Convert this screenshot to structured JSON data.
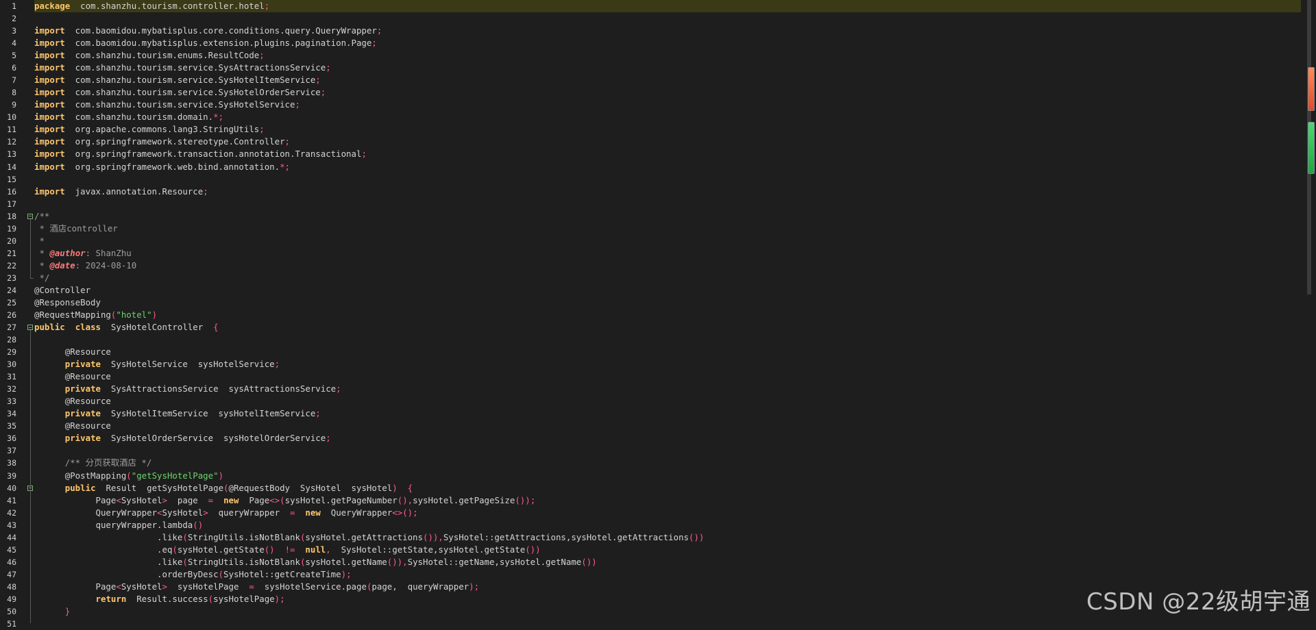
{
  "editor": {
    "current_line": 1,
    "lines": [
      [
        [
          "pk",
          "package"
        ],
        [
          "",
          "  com.shanzhu.tourism.controller.hotel"
        ],
        [
          "pn",
          ";"
        ]
      ],
      [],
      [
        [
          "kw",
          "import"
        ],
        [
          "",
          "  com.baomidou.mybatisplus.core.conditions.query.QueryWrapper"
        ],
        [
          "pn",
          ";"
        ]
      ],
      [
        [
          "kw",
          "import"
        ],
        [
          "",
          "  com.baomidou.mybatisplus.extension.plugins.pagination.Page"
        ],
        [
          "pn",
          ";"
        ]
      ],
      [
        [
          "kw",
          "import"
        ],
        [
          "",
          "  com.shanzhu.tourism.enums.ResultCode"
        ],
        [
          "pn",
          ";"
        ]
      ],
      [
        [
          "kw",
          "import"
        ],
        [
          "",
          "  com.shanzhu.tourism.service.SysAttractionsService"
        ],
        [
          "pn",
          ";"
        ]
      ],
      [
        [
          "kw",
          "import"
        ],
        [
          "",
          "  com.shanzhu.tourism.service.SysHotelItemService"
        ],
        [
          "pn",
          ";"
        ]
      ],
      [
        [
          "kw",
          "import"
        ],
        [
          "",
          "  com.shanzhu.tourism.service.SysHotelOrderService"
        ],
        [
          "pn",
          ";"
        ]
      ],
      [
        [
          "kw",
          "import"
        ],
        [
          "",
          "  com.shanzhu.tourism.service.SysHotelService"
        ],
        [
          "pn",
          ";"
        ]
      ],
      [
        [
          "kw",
          "import"
        ],
        [
          "",
          "  com.shanzhu.tourism.domain."
        ],
        [
          "pn",
          "*;"
        ]
      ],
      [
        [
          "kw",
          "import"
        ],
        [
          "",
          "  org.apache.commons.lang3.StringUtils"
        ],
        [
          "pn",
          ";"
        ]
      ],
      [
        [
          "kw",
          "import"
        ],
        [
          "",
          "  org.springframework.stereotype.Controller"
        ],
        [
          "pn",
          ";"
        ]
      ],
      [
        [
          "kw",
          "import"
        ],
        [
          "",
          "  org.springframework.transaction.annotation.Transactional"
        ],
        [
          "pn",
          ";"
        ]
      ],
      [
        [
          "kw",
          "import"
        ],
        [
          "",
          "  org.springframework.web.bind.annotation."
        ],
        [
          "pn",
          "*;"
        ]
      ],
      [],
      [
        [
          "kw",
          "import"
        ],
        [
          "",
          "  javax.annotation.Resource"
        ],
        [
          "pn",
          ";"
        ]
      ],
      [],
      [
        [
          "cm",
          "/**"
        ]
      ],
      [
        [
          "cm",
          " * 酒店controller"
        ]
      ],
      [
        [
          "cm",
          " *"
        ]
      ],
      [
        [
          "cm",
          " * "
        ],
        [
          "tag",
          "@author"
        ],
        [
          "cm",
          ": ShanZhu"
        ]
      ],
      [
        [
          "cm",
          " * "
        ],
        [
          "tag",
          "@date"
        ],
        [
          "cm",
          ": 2024-08-10"
        ]
      ],
      [
        [
          "cm",
          " */"
        ]
      ],
      [
        [
          "ann",
          "@Controller"
        ]
      ],
      [
        [
          "ann",
          "@ResponseBody"
        ]
      ],
      [
        [
          "ann",
          "@RequestMapping"
        ],
        [
          "pn",
          "("
        ],
        [
          "str",
          "\"hotel\""
        ],
        [
          "pn",
          ")"
        ]
      ],
      [
        [
          "kw",
          "public"
        ],
        [
          "",
          "  "
        ],
        [
          "kw",
          "class"
        ],
        [
          "",
          "  SysHotelController  "
        ],
        [
          "pn",
          "{"
        ]
      ],
      [],
      [
        [
          "",
          "      @Resource"
        ]
      ],
      [
        [
          "",
          "      "
        ],
        [
          "kw",
          "private"
        ],
        [
          "",
          "  SysHotelService  sysHotelService"
        ],
        [
          "pn",
          ";"
        ]
      ],
      [
        [
          "",
          "      @Resource"
        ]
      ],
      [
        [
          "",
          "      "
        ],
        [
          "kw",
          "private"
        ],
        [
          "",
          "  SysAttractionsService  sysAttractionsService"
        ],
        [
          "pn",
          ";"
        ]
      ],
      [
        [
          "",
          "      @Resource"
        ]
      ],
      [
        [
          "",
          "      "
        ],
        [
          "kw",
          "private"
        ],
        [
          "",
          "  SysHotelItemService  sysHotelItemService"
        ],
        [
          "pn",
          ";"
        ]
      ],
      [
        [
          "",
          "      @Resource"
        ]
      ],
      [
        [
          "",
          "      "
        ],
        [
          "kw",
          "private"
        ],
        [
          "",
          "  SysHotelOrderService  sysHotelOrderService"
        ],
        [
          "pn",
          ";"
        ]
      ],
      [],
      [
        [
          "cm",
          "      /** 分页获取酒店 */"
        ]
      ],
      [
        [
          "",
          "      @PostMapping"
        ],
        [
          "pn",
          "("
        ],
        [
          "str",
          "\"getSysHotelPage\""
        ],
        [
          "pn",
          ")"
        ]
      ],
      [
        [
          "",
          "      "
        ],
        [
          "kw",
          "public"
        ],
        [
          "",
          "  Result  getSysHotelPage"
        ],
        [
          "pn",
          "("
        ],
        [
          "",
          "@RequestBody  SysHotel  sysHotel"
        ],
        [
          "pn",
          ")"
        ],
        [
          "",
          "  "
        ],
        [
          "pn",
          "{"
        ]
      ],
      [
        [
          "",
          "            Page"
        ],
        [
          "pn",
          "<"
        ],
        [
          "",
          "SysHotel"
        ],
        [
          "pn",
          ">"
        ],
        [
          "",
          "  page  "
        ],
        [
          "pn",
          "="
        ],
        [
          "",
          "  "
        ],
        [
          "kw",
          "new"
        ],
        [
          "",
          "  Page"
        ],
        [
          "pn",
          "<>("
        ],
        [
          "",
          "sysHotel.getPageNumber"
        ],
        [
          "pn",
          "(),"
        ],
        [
          "",
          "sysHotel.getPageSize"
        ],
        [
          "pn",
          "());"
        ]
      ],
      [
        [
          "",
          "            QueryWrapper"
        ],
        [
          "pn",
          "<"
        ],
        [
          "",
          "SysHotel"
        ],
        [
          "pn",
          ">"
        ],
        [
          "",
          "  queryWrapper  "
        ],
        [
          "pn",
          "="
        ],
        [
          "",
          "  "
        ],
        [
          "kw",
          "new"
        ],
        [
          "",
          "  QueryWrapper"
        ],
        [
          "pn",
          "<>();"
        ]
      ],
      [
        [
          "",
          "            queryWrapper.lambda"
        ],
        [
          "pn",
          "()"
        ]
      ],
      [
        [
          "",
          "                        .like"
        ],
        [
          "pn",
          "("
        ],
        [
          "",
          "StringUtils.isNotBlank"
        ],
        [
          "pn",
          "("
        ],
        [
          "",
          "sysHotel.getAttractions"
        ],
        [
          "pn",
          "()),"
        ],
        [
          "",
          "SysHotel::getAttractions,sysHotel.getAttractions"
        ],
        [
          "pn",
          "())"
        ]
      ],
      [
        [
          "",
          "                        .eq"
        ],
        [
          "pn",
          "("
        ],
        [
          "",
          "sysHotel.getState"
        ],
        [
          "pn",
          "()"
        ],
        [
          "",
          "  "
        ],
        [
          "pn",
          "!="
        ],
        [
          "",
          "  "
        ],
        [
          "kw",
          "null"
        ],
        [
          "pn",
          ","
        ],
        [
          "",
          "  SysHotel::getState,sysHotel.getState"
        ],
        [
          "pn",
          "())"
        ]
      ],
      [
        [
          "",
          "                        .like"
        ],
        [
          "pn",
          "("
        ],
        [
          "",
          "StringUtils.isNotBlank"
        ],
        [
          "pn",
          "("
        ],
        [
          "",
          "sysHotel.getName"
        ],
        [
          "pn",
          "()),"
        ],
        [
          "",
          "SysHotel::getName,sysHotel.getName"
        ],
        [
          "pn",
          "())"
        ]
      ],
      [
        [
          "",
          "                        .orderByDesc"
        ],
        [
          "pn",
          "("
        ],
        [
          "",
          "SysHotel::getCreateTime"
        ],
        [
          "pn",
          ");"
        ]
      ],
      [
        [
          "",
          "            Page"
        ],
        [
          "pn",
          "<"
        ],
        [
          "",
          "SysHotel"
        ],
        [
          "pn",
          ">"
        ],
        [
          "",
          "  sysHotelPage  "
        ],
        [
          "pn",
          "="
        ],
        [
          "",
          "  sysHotelService.page"
        ],
        [
          "pn",
          "("
        ],
        [
          "",
          "page,  queryWrapper"
        ],
        [
          "pn",
          ");"
        ]
      ],
      [
        [
          "",
          "            "
        ],
        [
          "kw",
          "return"
        ],
        [
          "",
          "  Result.success"
        ],
        [
          "pn",
          "("
        ],
        [
          "",
          "sysHotelPage"
        ],
        [
          "pn",
          ");"
        ]
      ],
      [
        [
          "",
          "      "
        ],
        [
          "pn",
          "}"
        ]
      ],
      []
    ]
  },
  "fold_markers": [
    18,
    27,
    40
  ],
  "watermark": "CSDN @22级胡宇通"
}
